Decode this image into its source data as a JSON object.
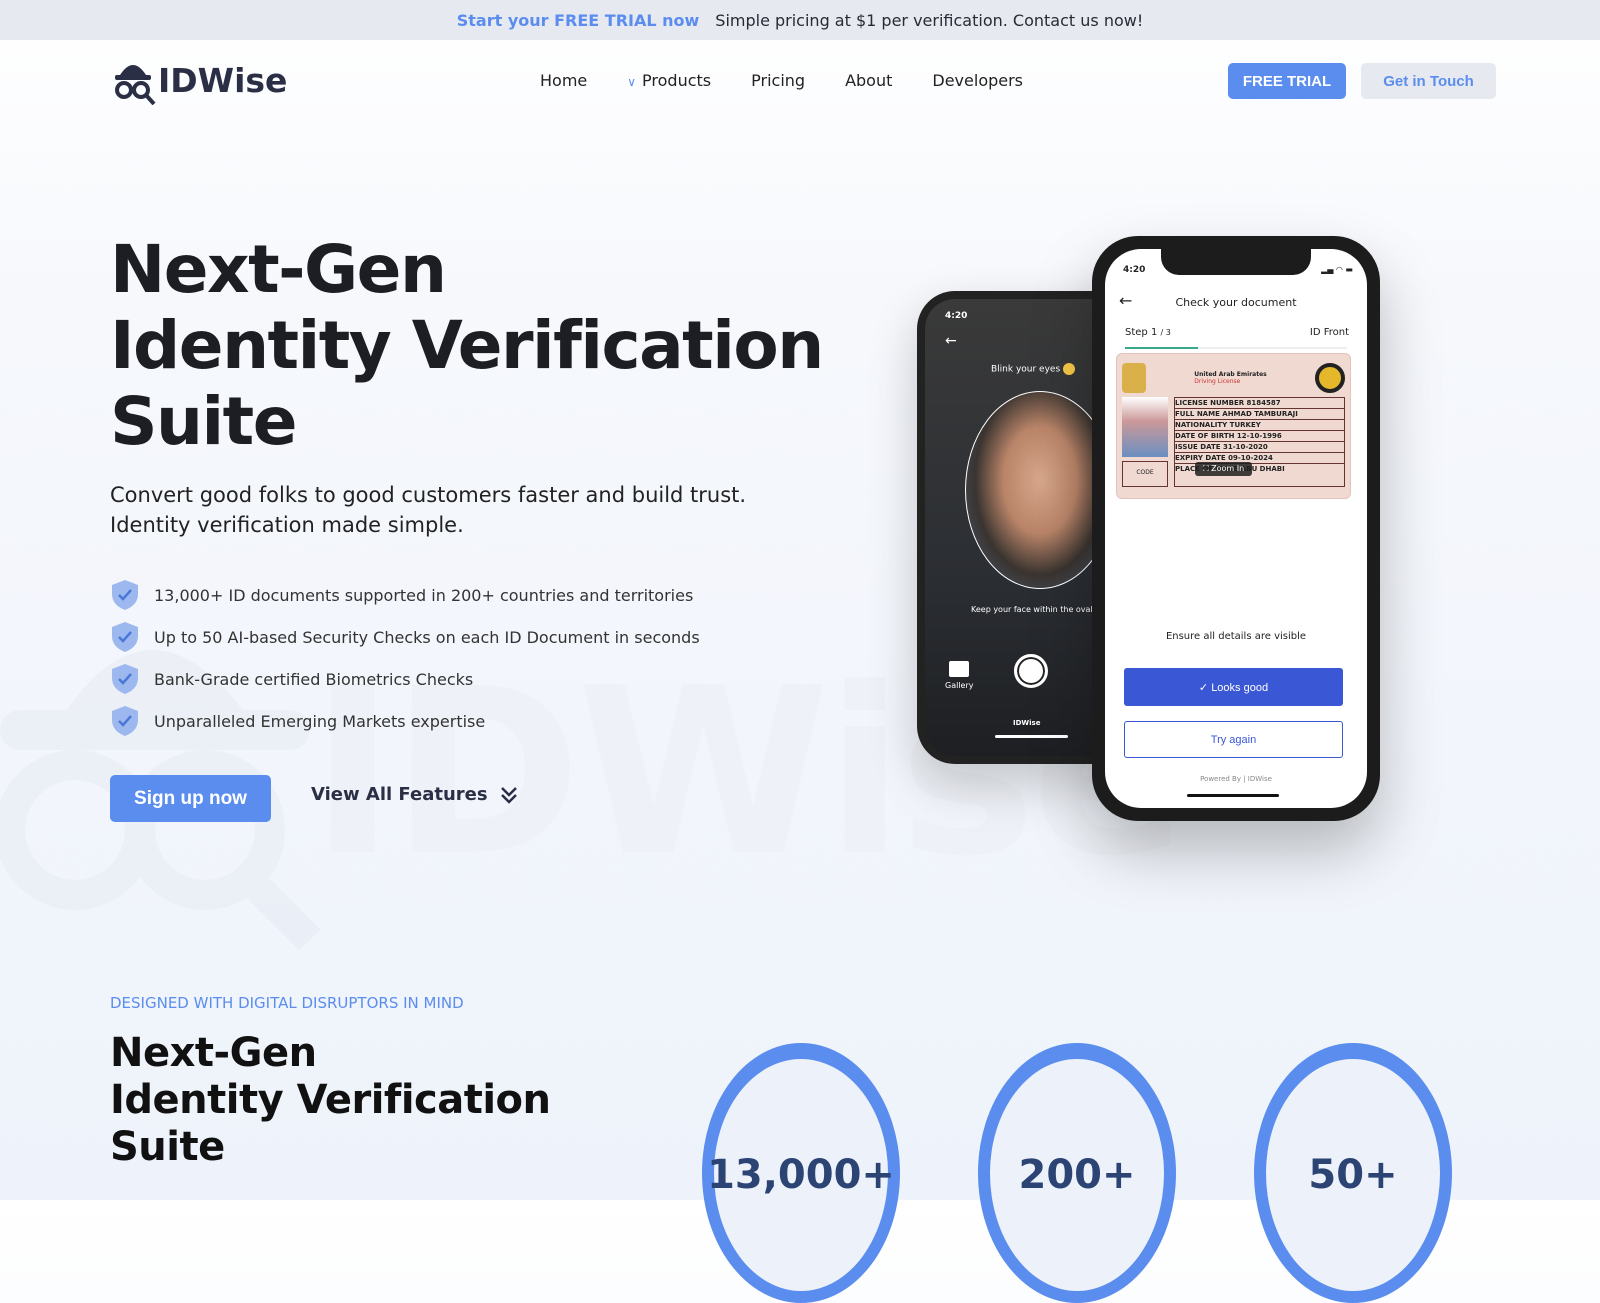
{
  "announcement": {
    "highlight": "Start your FREE TRIAL now",
    "message": "Simple pricing at $1 per verification. Contact us now!"
  },
  "brand": {
    "name": "IDWise",
    "accent": "#5b8def"
  },
  "nav": {
    "items": [
      "Home",
      "Products",
      "Pricing",
      "About",
      "Developers"
    ],
    "free_trial": "FREE TRIAL",
    "get_in_touch": "Get in Touch"
  },
  "hero": {
    "title_lines": [
      "Next-Gen",
      "Identity Verification",
      "Suite"
    ],
    "subtitle_lines": [
      "Convert good folks to good customers faster and build trust.",
      "Identity verification made simple."
    ],
    "features": [
      "13,000+ ID documents supported in 200+ countries and territories",
      "Up to 50 AI-based Security Checks on each ID Document in seconds",
      "Bank-Grade certified Biometrics Checks",
      "Unparalleled Emerging Markets expertise"
    ],
    "signup": "Sign up now",
    "view_all": "View All Features"
  },
  "phone_selfie": {
    "time": "4:20",
    "prompt": "Blink your eyes",
    "hint": "Keep your face within the oval",
    "gallery": "Gallery",
    "brand": "IDWise"
  },
  "phone_doc": {
    "time": "4:20",
    "title": "Check your document",
    "step": "Step 1",
    "step_total": "/ 3",
    "side": "ID Front",
    "progress": 0.33,
    "card": {
      "country": "United Arab Emirates",
      "type": "Driving License",
      "rows": [
        "LICENSE NUMBER  8184587",
        "FULL NAME  AHMAD TAMBURAJI",
        "NATIONALITY  TURKEY",
        "DATE OF BIRTH  12-10-1996",
        "ISSUE DATE  31-10-2020",
        "EXPIRY DATE  09-10-2024",
        "PLACE OF ISSUE  ABU DHABI"
      ],
      "code": "CODE",
      "zoom": "Zoom In"
    },
    "ensure": "Ensure all details are visible",
    "looks_good": "Looks good",
    "try_again": "Try again",
    "powered": "Powered By | IDWise"
  },
  "section2": {
    "eyebrow": "DESIGNED WITH DIGITAL DISRUPTORS IN MIND",
    "title_lines": [
      "Next-Gen",
      "Identity Verification",
      "Suite"
    ],
    "stats": [
      "13,000+",
      "200+",
      "50+"
    ]
  }
}
